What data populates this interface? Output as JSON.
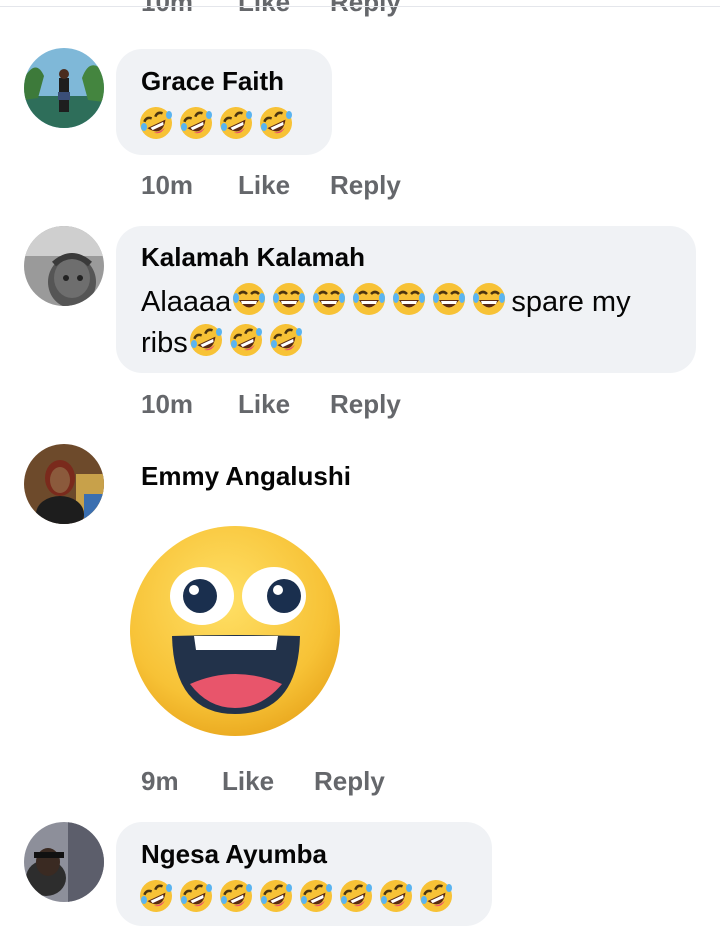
{
  "top_actions": {
    "time": "10m",
    "like": "Like",
    "reply": "Reply"
  },
  "comments": [
    {
      "author": "Grace Faith",
      "text_segments": [],
      "emoji": [
        "rofl-emoji",
        "rofl-emoji",
        "rofl-emoji",
        "rofl-emoji"
      ],
      "time": "10m",
      "like": "Like",
      "reply": "Reply"
    },
    {
      "author": "Kalamah Kalamah",
      "line1_prefix": "Alaaaa",
      "line1_emoji": [
        "joy-emoji",
        "joy-emoji",
        "joy-emoji",
        "joy-emoji",
        "joy-emoji",
        "joy-emoji",
        "joy-emoji"
      ],
      "line1_suffix": "spare my",
      "line2_prefix": "ribs",
      "line2_emoji": [
        "rofl-emoji",
        "rofl-emoji",
        "rofl-emoji"
      ],
      "time": "10m",
      "like": "Like",
      "reply": "Reply"
    },
    {
      "author": "Emmy Angalushi",
      "sticker": "grinning-face-sticker",
      "time": "9m",
      "like": "Like",
      "reply": "Reply"
    },
    {
      "author": "Ngesa Ayumba",
      "emoji": [
        "rofl-emoji",
        "rofl-emoji",
        "rofl-emoji",
        "rofl-emoji",
        "rofl-emoji",
        "rofl-emoji",
        "rofl-emoji",
        "rofl-emoji"
      ]
    }
  ],
  "colors": {
    "bubble": "#f0f2f5",
    "meta": "#65676b",
    "text": "#050505",
    "emoji_yellow": "#f7c236"
  }
}
